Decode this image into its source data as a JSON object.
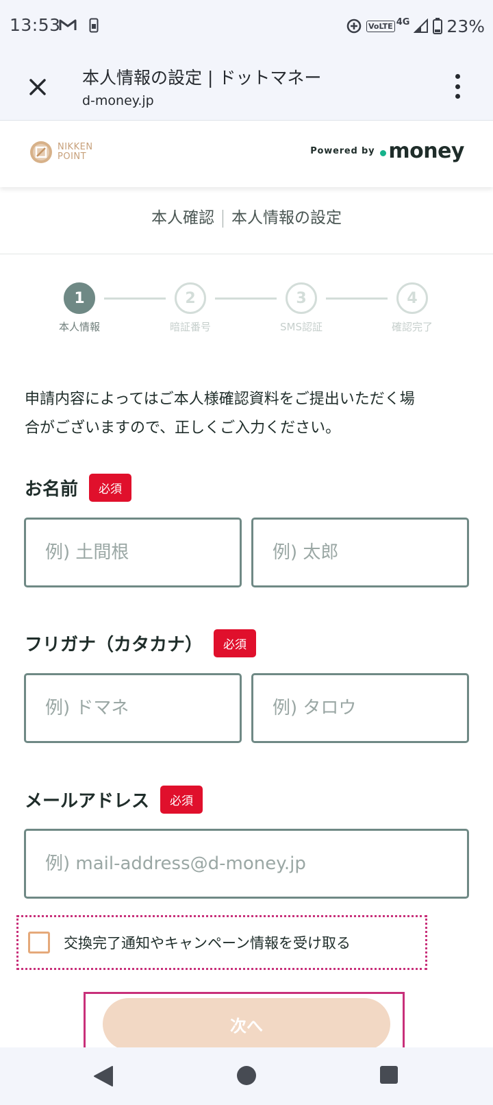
{
  "status_bar": {
    "time": "13:53",
    "network": "4G",
    "volte": "VoLTE",
    "battery": "23%",
    "icons": [
      "gmail-icon",
      "sim-icon",
      "data-saver-icon",
      "volte-icon",
      "signal-icon",
      "battery-icon"
    ]
  },
  "browser": {
    "title": "本人情報の設定 | ドットマネー",
    "url": "d-money.jp",
    "close_icon": "close-icon",
    "menu_icon": "more-vert-icon"
  },
  "site_header": {
    "brand_line1": "NIKKEN",
    "brand_line2": "POINT",
    "powered_by": "Powered by",
    "money_logo": "money",
    "accent_color": "#16b28b"
  },
  "section": {
    "title_left": "本人確認",
    "title_right": "本人情報の設定"
  },
  "stepper": {
    "steps": [
      {
        "number": "1",
        "label": "本人情報"
      },
      {
        "number": "2",
        "label": "暗証番号"
      },
      {
        "number": "3",
        "label": "SMS認証"
      },
      {
        "number": "4",
        "label": "確認完了"
      }
    ]
  },
  "description_line1": "申請内容によってはご本人様確認資料をご提出いただく場",
  "description_line2": "合がございますので、正しくご入力ください。",
  "form": {
    "required_label": "必須",
    "name": {
      "label": "お名前",
      "last_placeholder": "例) 土間根",
      "first_placeholder": "例) 太郎"
    },
    "kana": {
      "label": "フリガナ（カタカナ）",
      "last_placeholder": "例) ドマネ",
      "first_placeholder": "例) タロウ"
    },
    "email": {
      "label": "メールアドレス",
      "placeholder": "例) mail-address@d-money.jp"
    },
    "opt_in_label": "交換完了通知やキャンペーン情報を受け取る",
    "next_button": "次へ"
  },
  "colors": {
    "required": "#e0102c",
    "input_border": "#6f8985",
    "button_disabled": "#f2d8c4",
    "highlight": "#c8307a"
  }
}
